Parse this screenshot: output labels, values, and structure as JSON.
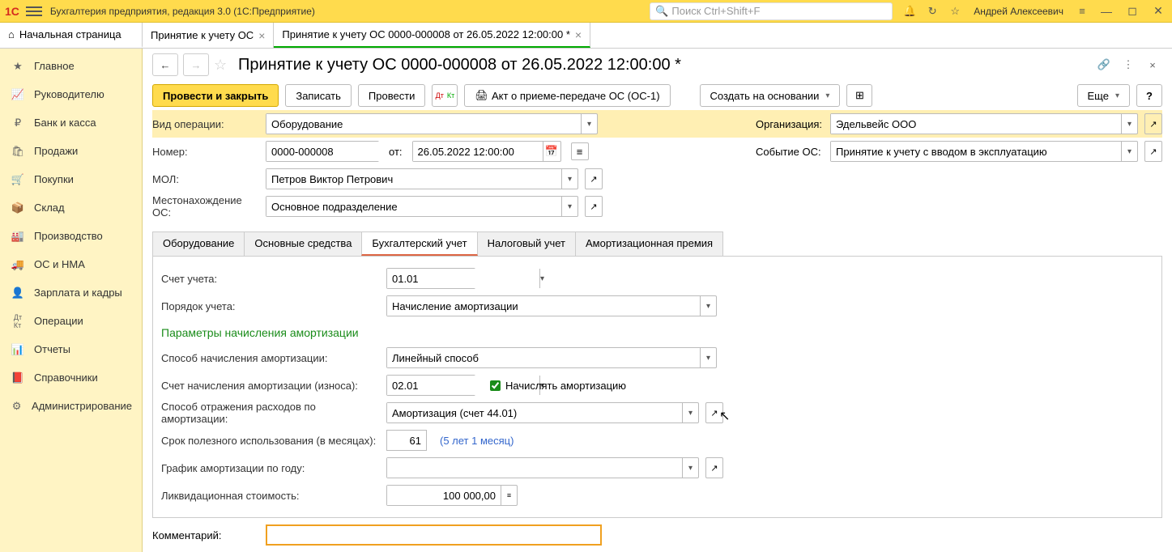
{
  "topbar": {
    "app_title": "Бухгалтерия предприятия, редакция 3.0  (1С:Предприятие)",
    "search_placeholder": "Поиск Ctrl+Shift+F",
    "username": "Андрей Алексеевич"
  },
  "tabs": {
    "home": "Начальная страница",
    "t1": "Принятие к учету ОС",
    "t2": "Принятие к учету ОС 0000-000008 от 26.05.2022 12:00:00 *"
  },
  "sidebar": [
    "Главное",
    "Руководителю",
    "Банк и касса",
    "Продажи",
    "Покупки",
    "Склад",
    "Производство",
    "ОС и НМА",
    "Зарплата и кадры",
    "Операции",
    "Отчеты",
    "Справочники",
    "Администрирование"
  ],
  "doc_title": "Принятие к учету ОС 0000-000008 от 26.05.2022 12:00:00 *",
  "toolbar": {
    "post_close": "Провести и закрыть",
    "save": "Записать",
    "post": "Провести",
    "print": "Акт о приеме-передаче ОС (ОС-1)",
    "create_based": "Создать на основании",
    "more": "Еще"
  },
  "form": {
    "op_type_label": "Вид операции:",
    "op_type_value": "Оборудование",
    "org_label": "Организация:",
    "org_value": "Эдельвейс ООО",
    "number_label": "Номер:",
    "number_value": "0000-000008",
    "from_label": "от:",
    "date_value": "26.05.2022 12:00:00",
    "event_label": "Событие ОС:",
    "event_value": "Принятие к учету с вводом в эксплуатацию",
    "mol_label": "МОЛ:",
    "mol_value": "Петров Виктор Петрович",
    "location_label": "Местонахождение ОС:",
    "location_value": "Основное подразделение",
    "comment_label": "Комментарий:",
    "comment_value": ""
  },
  "inner_tabs": [
    "Оборудование",
    "Основные средства",
    "Бухгалтерский учет",
    "Налоговый учет",
    "Амортизационная премия"
  ],
  "accounting": {
    "account_label": "Счет учета:",
    "account_value": "01.01",
    "order_label": "Порядок учета:",
    "order_value": "Начисление амортизации",
    "section_title": "Параметры начисления амортизации",
    "method_label": "Способ начисления амортизации:",
    "method_value": "Линейный способ",
    "depr_account_label": "Счет начисления амортизации (износа):",
    "depr_account_value": "02.01",
    "calc_depr_label": "Начислять амортизацию",
    "expense_method_label": "Способ отражения расходов по амортизации:",
    "expense_method_value": "Амортизация (счет 44.01)",
    "useful_life_label": "Срок полезного использования (в месяцах):",
    "useful_life_value": "61",
    "useful_life_hint": "(5 лет 1 месяц)",
    "schedule_label": "График амортизации по году:",
    "schedule_value": "",
    "salvage_label": "Ликвидационная стоимость:",
    "salvage_value": "100 000,00"
  }
}
